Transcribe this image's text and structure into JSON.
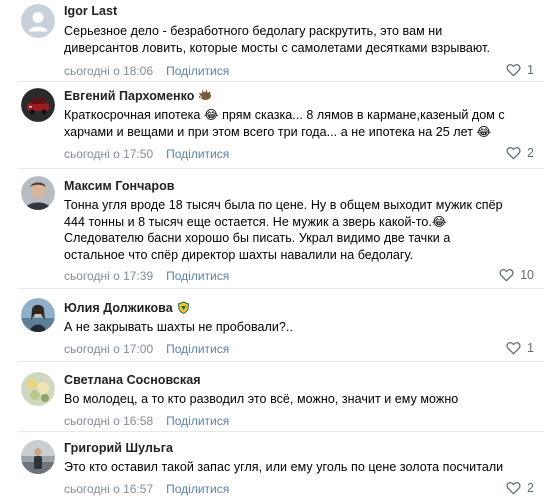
{
  "comments": [
    {
      "author": "Igor Last",
      "badge": "",
      "avatar": "default-avatar",
      "lines": [
        "Серьезное дело - безработного бедолагу раскрутить, это вам ни",
        "диверсантов ловить, которые мосты с самолетами десятками взрывают."
      ],
      "time": "сьогодні о 18:06",
      "share": "Поділитися",
      "likes": "1"
    },
    {
      "author": "Евгений Пархоменко",
      "badge": "hedgehog",
      "avatar": "car-avatar",
      "lines": [
        "Краткосрочная ипотека 😂 прям сказка... 8 лямов в кармане,казеный дом с",
        "харчами и вещами и при этом всего три года... а не ипотека на 25 лет 😂"
      ],
      "time": "сьогодні о 17:50",
      "share": "Поділитися",
      "likes": "2"
    },
    {
      "author": "Максим Гончаров",
      "badge": "",
      "avatar": "man-avatar",
      "lines": [
        "Тонна угля вроде 18 тысяч была по цене. Ну в общем выходит мужик спёр",
        "444 тонны и 8 тысяч еще остается. Не мужик а зверь какой-то.😂",
        "Следователю басни хорошо бы писать. Украл видимо две тачки а",
        "остальное что спёр директор шахты навалили на бедолагу."
      ],
      "time": "сьогодні о 17:39",
      "share": "Поділитися",
      "likes": "10"
    },
    {
      "author": "Юлия Должикова",
      "badge": "crest",
      "avatar": "woman-avatar",
      "lines": [
        "А не закрывать шахты не пробовали?.."
      ],
      "time": "сьогодні о 17:00",
      "share": "Поділитися",
      "likes": "1"
    },
    {
      "author": "Светлана Сосновская",
      "badge": "",
      "avatar": "flowers-avatar",
      "lines": [
        "Во молодец, а то кто разводил это всё, можно, значит и ему можно"
      ],
      "time": "сьогодні о 16:58",
      "share": "Поділитися",
      "likes": ""
    },
    {
      "author": "Григорий Шульга",
      "badge": "",
      "avatar": "street-avatar",
      "lines": [
        "Это кто оставил такой запас угля, или ему уголь по цене золота посчитали"
      ],
      "time": "сьогодні о 16:57",
      "share": "Поділитися",
      "likes": "2"
    }
  ],
  "colors": {
    "author": "#222222",
    "meta": "#818c99",
    "link": "#5a7fa8",
    "likes": "#626d7a",
    "divider": "#e7e8ec"
  }
}
